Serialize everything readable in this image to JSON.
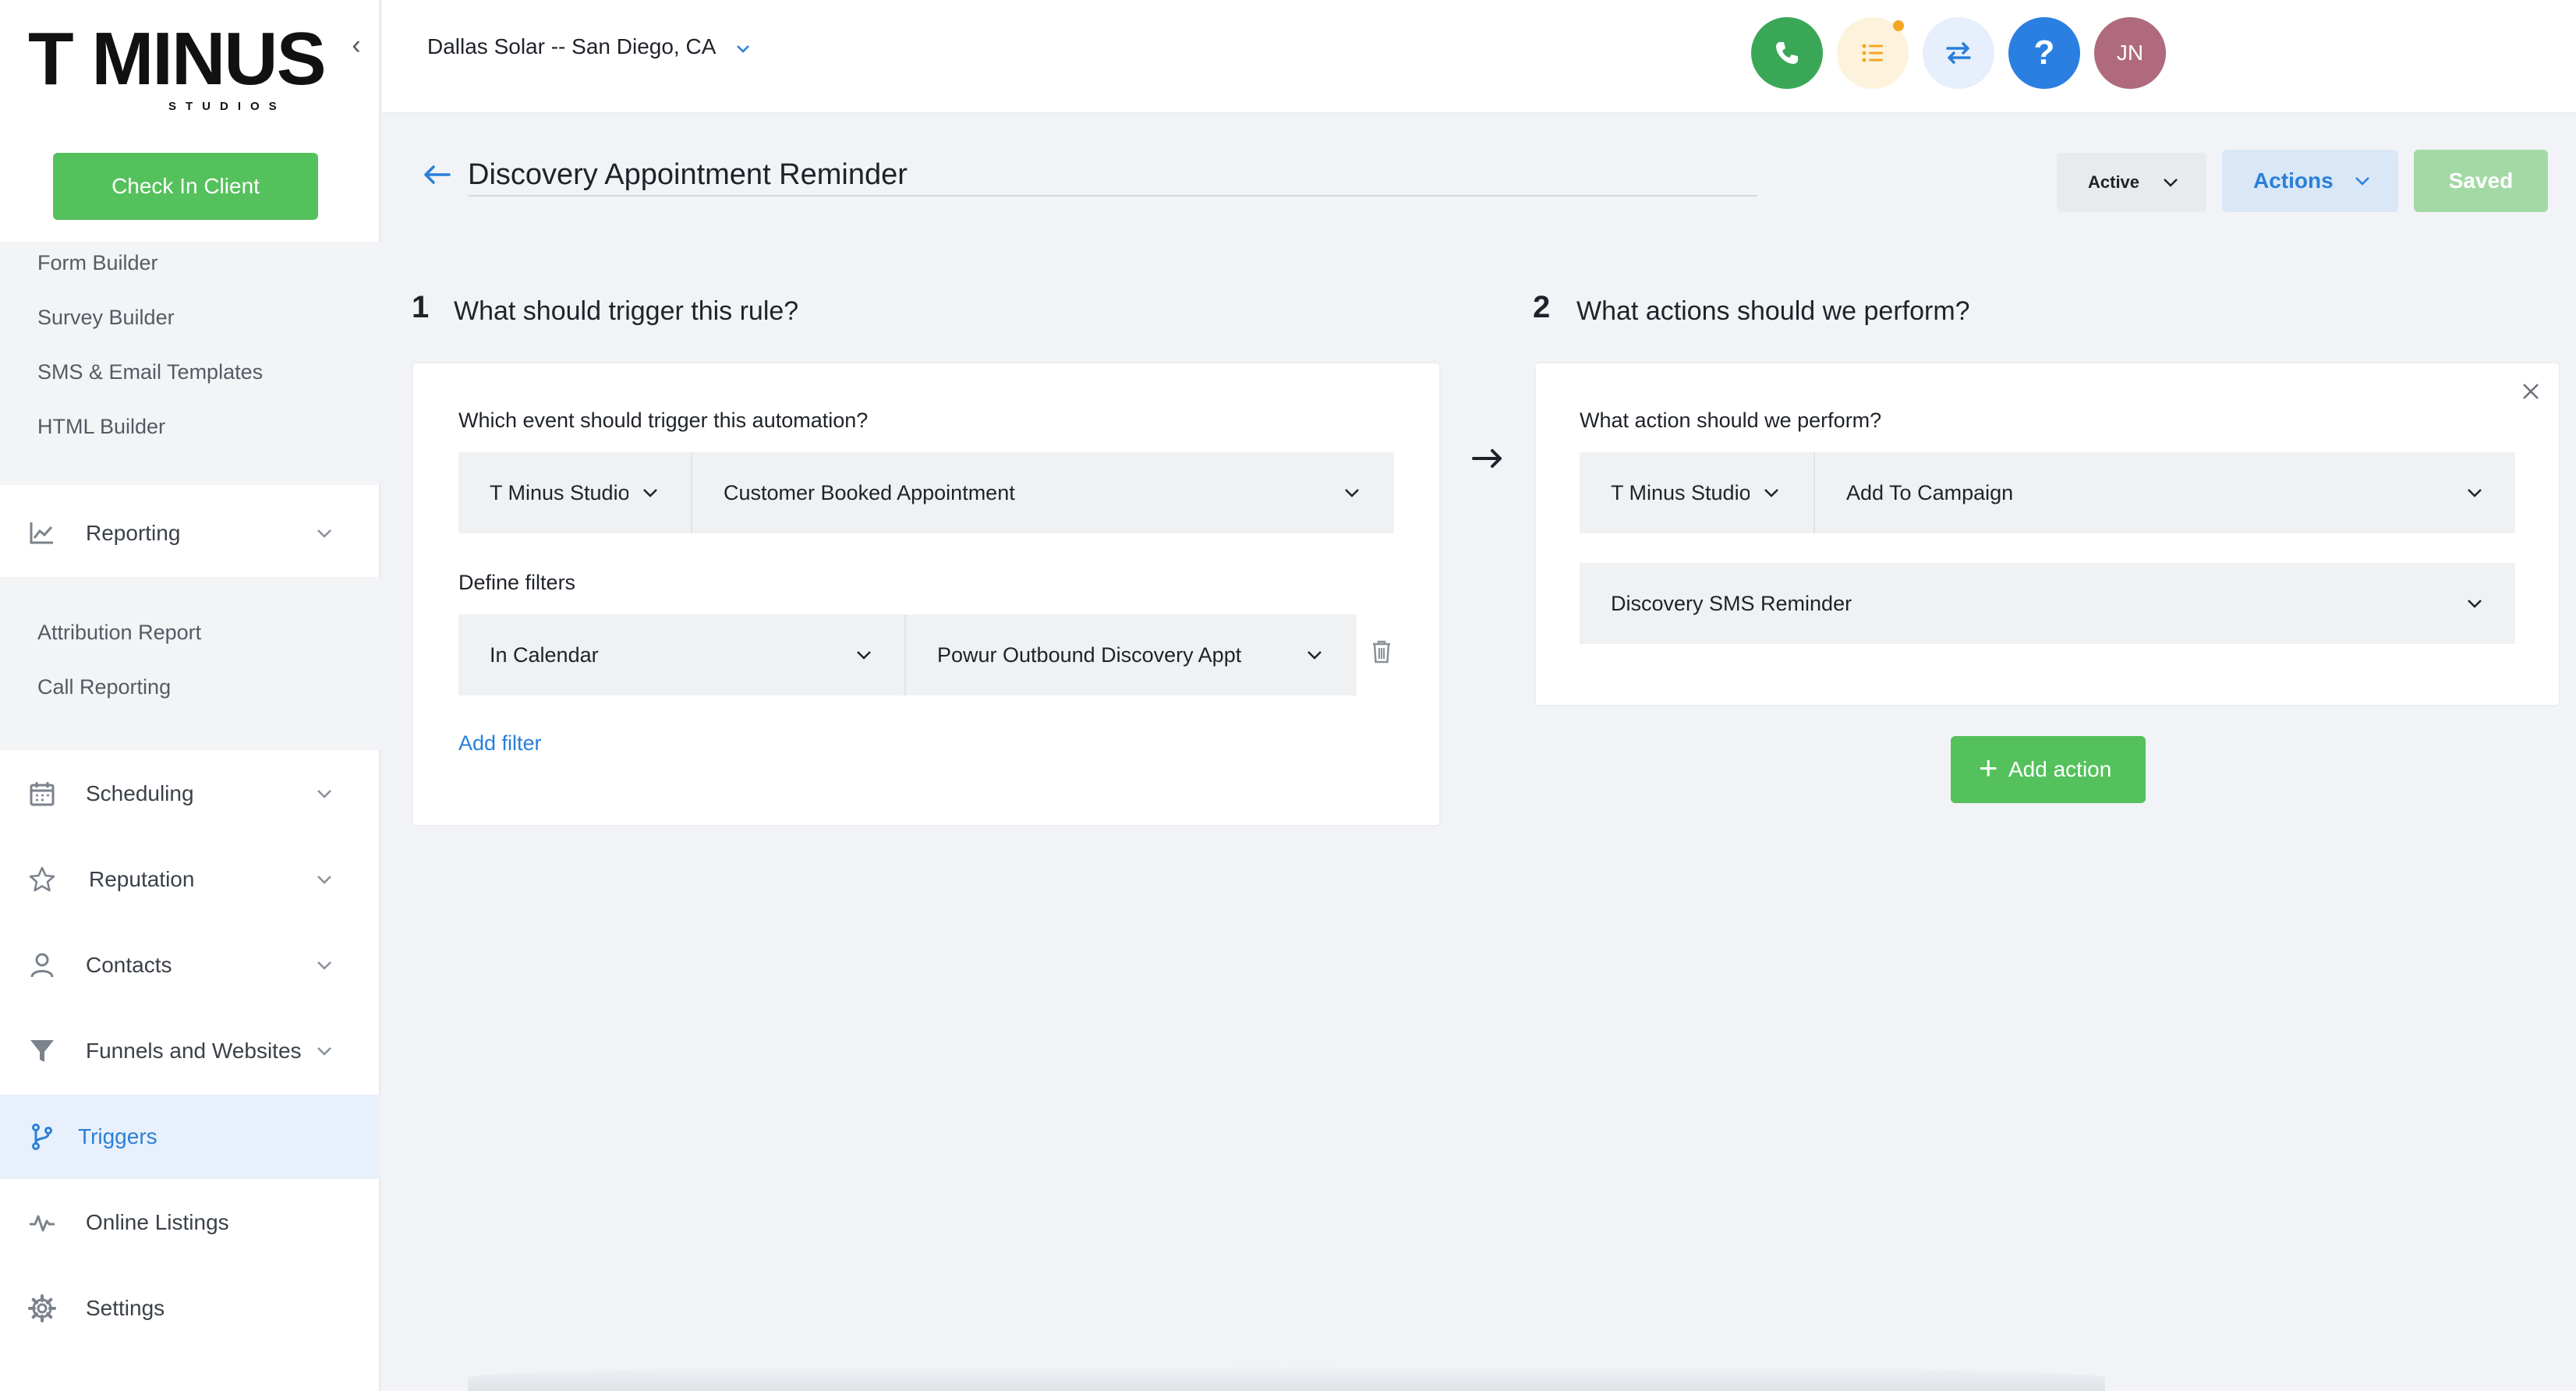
{
  "sidebar": {
    "logo_text": "T MINUS",
    "logo_subtext": "STUDIOS",
    "check_in_label": "Check In Client",
    "marketing_sub_items": [
      {
        "label": "Form Builder"
      },
      {
        "label": "Survey Builder"
      },
      {
        "label": "SMS & Email Templates"
      },
      {
        "label": "HTML Builder"
      }
    ],
    "reporting": {
      "label": "Reporting",
      "icon": "chart-line-icon"
    },
    "reporting_sub_items": [
      {
        "label": "Attribution Report"
      },
      {
        "label": "Call Reporting"
      }
    ],
    "nav_items": [
      {
        "label": "Scheduling",
        "icon": "calendar-icon"
      },
      {
        "label": "Reputation",
        "icon": "star-icon"
      },
      {
        "label": "Contacts",
        "icon": "person-icon"
      },
      {
        "label": "Funnels and Websites",
        "icon": "funnel-icon"
      },
      {
        "label": "Triggers",
        "icon": "branch-icon",
        "active": true
      },
      {
        "label": "Online Listings",
        "icon": "pulse-icon"
      },
      {
        "label": "Settings",
        "icon": "gear-icon"
      }
    ]
  },
  "header": {
    "location": "Dallas Solar -- San Diego, CA",
    "avatar_initials": "JN",
    "help_glyph": "?"
  },
  "page": {
    "title": "Discovery Appointment Reminder",
    "status": "Active",
    "actions_label": "Actions",
    "saved_label": "Saved"
  },
  "trigger_section": {
    "number": "1",
    "title": "What should trigger this rule?",
    "event_label": "Which event should trigger this automation?",
    "event_source": "T Minus Studios",
    "event_type": "Customer Booked Appointment",
    "filters_label": "Define filters",
    "filter_field": "In Calendar",
    "filter_value": "Powur Outbound Discovery Appt",
    "add_filter_label": "Add filter"
  },
  "action_section": {
    "number": "2",
    "title": "What actions should we perform?",
    "action_label": "What action should we perform?",
    "action_source": "T Minus Studios",
    "action_type": "Add To Campaign",
    "campaign": "Discovery SMS Reminder",
    "add_action_label": "Add action"
  },
  "colors": {
    "primary_green": "#55c15c",
    "accent_blue": "#2a7fd9",
    "phone_green": "#3aa757",
    "notification_orange": "#f5a623",
    "avatar_bg": "#b06a7d"
  }
}
